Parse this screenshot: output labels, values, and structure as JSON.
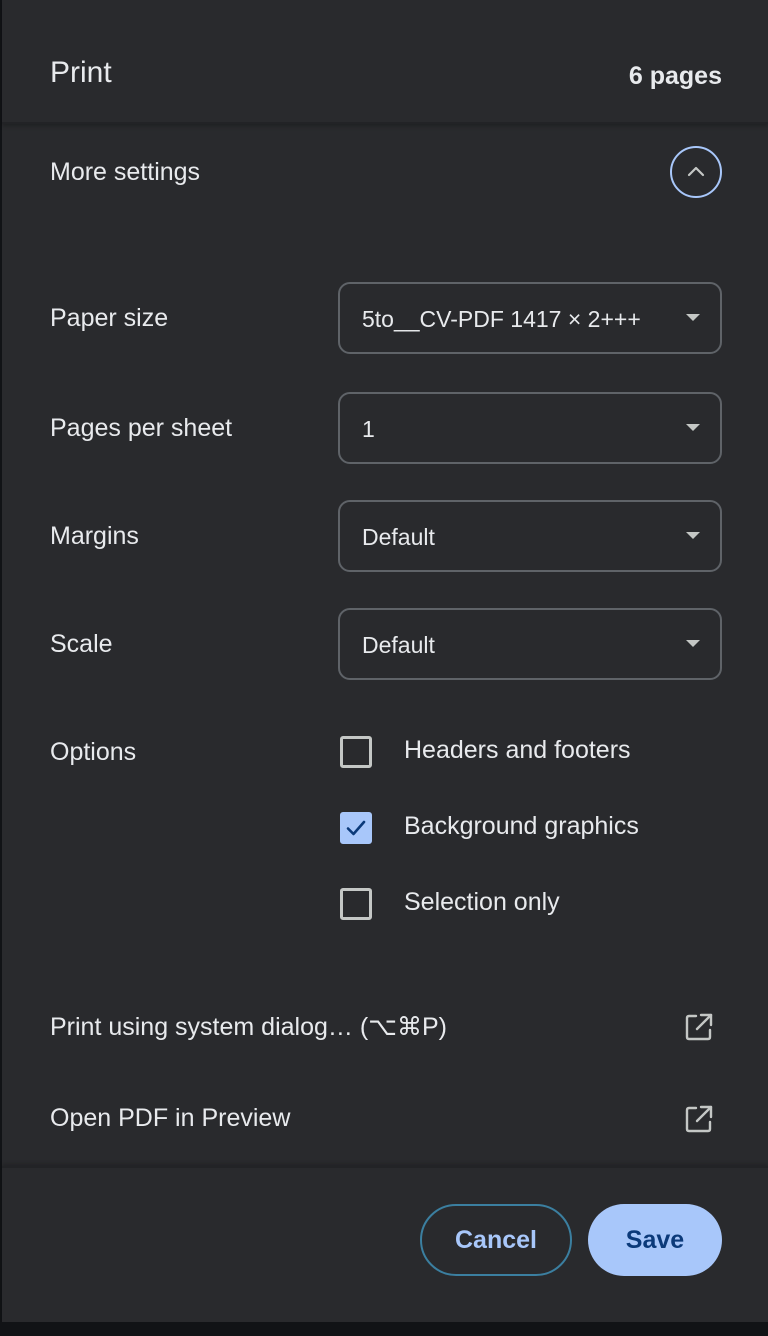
{
  "header": {
    "title": "Print",
    "page_count": "6 pages"
  },
  "more_settings": {
    "label": "More settings",
    "expanded": true,
    "collapse_icon": "chevron-up-icon"
  },
  "settings": {
    "paper_size": {
      "label": "Paper size",
      "value": "5to__CV-PDF 1417 × 2+++"
    },
    "pages_per_sheet": {
      "label": "Pages per sheet",
      "value": "1"
    },
    "margins": {
      "label": "Margins",
      "value": "Default"
    },
    "scale": {
      "label": "Scale",
      "value": "Default"
    }
  },
  "options": {
    "label": "Options",
    "items": [
      {
        "label": "Headers and footers",
        "checked": false
      },
      {
        "label": "Background graphics",
        "checked": true
      },
      {
        "label": "Selection only",
        "checked": false
      }
    ]
  },
  "links": {
    "system_dialog": {
      "label": "Print using system dialog… (⌥⌘P)",
      "icon": "open-in-new-icon"
    },
    "open_preview": {
      "label": "Open PDF in Preview",
      "icon": "open-in-new-icon"
    }
  },
  "footer": {
    "cancel_label": "Cancel",
    "save_label": "Save"
  },
  "colors": {
    "background": "#292a2d",
    "accent": "#a8c7fa",
    "text": "#e8eaed"
  }
}
